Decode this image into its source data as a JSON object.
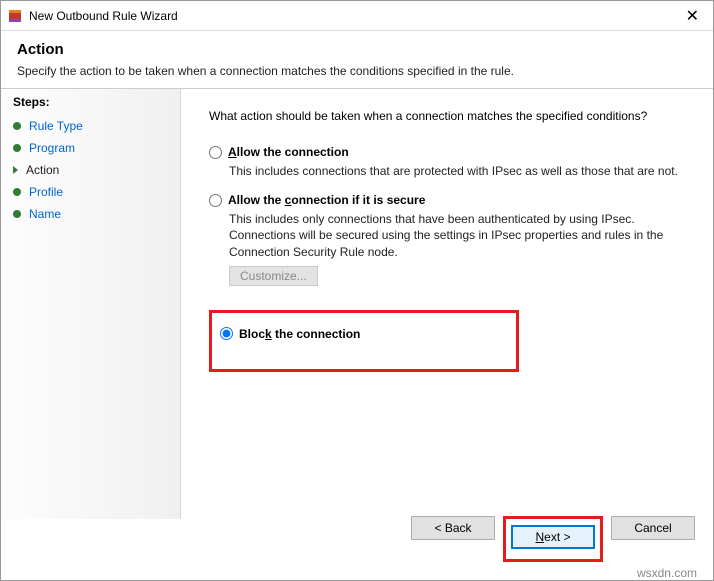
{
  "titlebar": {
    "title": "New Outbound Rule Wizard"
  },
  "header": {
    "title": "Action",
    "desc": "Specify the action to be taken when a connection matches the conditions specified in the rule."
  },
  "sidebar": {
    "steps_label": "Steps:",
    "items": [
      {
        "label": "Rule Type",
        "current": false
      },
      {
        "label": "Program",
        "current": false
      },
      {
        "label": "Action",
        "current": true
      },
      {
        "label": "Profile",
        "current": false
      },
      {
        "label": "Name",
        "current": false
      }
    ]
  },
  "main": {
    "prompt": "What action should be taken when a connection matches the specified conditions?",
    "options": {
      "allow": {
        "prefix": "A",
        "rest": "llow the connection",
        "desc": "This includes connections that are protected with IPsec as well as those that are not."
      },
      "allow_secure": {
        "prefix": "Allow the ",
        "u": "c",
        "rest": "onnection if it is secure",
        "desc": "This includes only connections that have been authenticated by using IPsec. Connections will be secured using the settings in IPsec properties and rules in the Connection Security Rule node."
      },
      "customize_btn": "Customize...",
      "block": {
        "prefix": "Bloc",
        "u": "k",
        "rest": " the connection"
      }
    }
  },
  "footer": {
    "back": "< Back",
    "next": "Next >",
    "cancel": "Cancel"
  },
  "watermark": "wsxdn.com"
}
